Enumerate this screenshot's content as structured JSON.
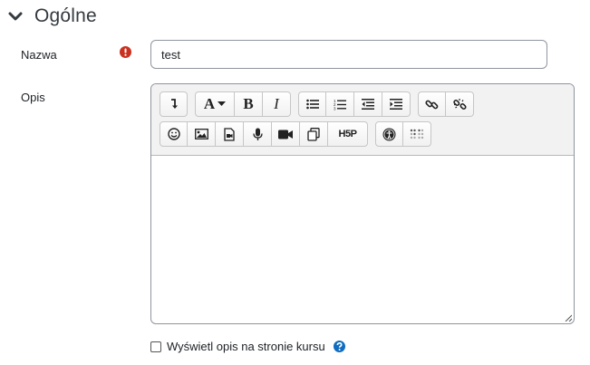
{
  "section": {
    "title": "Ogólne",
    "icon": "chevron-down-icon"
  },
  "name_field": {
    "label": "Nazwa",
    "value": "test",
    "required_icon": "exclamation-circle-icon",
    "required_color": "#ca3120"
  },
  "description": {
    "label": "Opis",
    "toolbar": {
      "row1": [
        [
          "collapse-icon"
        ],
        [
          "font-icon",
          "bold-icon",
          "italic-icon"
        ],
        [
          "unordered-list-icon",
          "ordered-list-icon",
          "outdent-icon",
          "indent-icon"
        ],
        [
          "link-icon",
          "unlink-icon"
        ]
      ],
      "row2": [
        [
          "emoji-icon",
          "image-icon",
          "media-icon",
          "record-audio-icon",
          "record-video-icon",
          "manage-files-icon",
          "h5p-icon"
        ],
        [
          "accessibility-checker-icon",
          "screenreader-helper-icon"
        ]
      ],
      "h5p_label": "H5P",
      "bold_label": "B",
      "italic_label": "I",
      "font_label": "A"
    },
    "content": ""
  },
  "show_description": {
    "label": "Wyświetl opis na stronie kursu",
    "checked": false,
    "help_icon": "question-circle-icon",
    "help_color": "#0f6cbf"
  }
}
